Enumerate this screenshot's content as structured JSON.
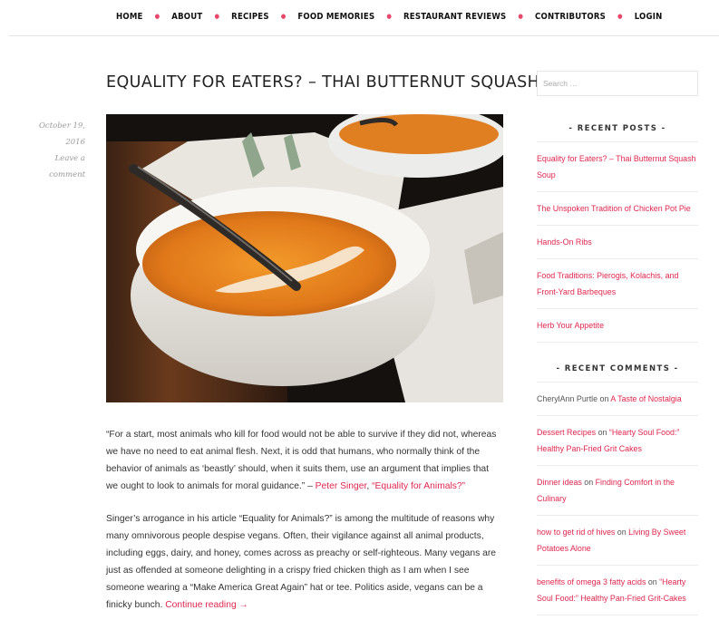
{
  "nav": {
    "items": [
      "HOME",
      "ABOUT",
      "RECIPES",
      "FOOD MEMORIES",
      "RESTAURANT REVIEWS",
      "CONTRIBUTORS",
      "LOGIN"
    ]
  },
  "post": {
    "title": "EQUALITY FOR EATERS? – THAI BUTTERNUT SQUASH SOUP",
    "date": "October 19, 2016",
    "comment_link": "Leave a comment",
    "quote_text": "“For a start, most animals who kill for food would not be able to survive if they did not, whereas we have no need to eat animal flesh. Next, it is odd that humans, who normally think of the behavior of animals as ‘beastly’ should, when it suits them, use an argument that implies that we ought to look to animals for moral guidance.” – ",
    "quote_author": "Peter Singer",
    "quote_sep": ", ",
    "quote_source": "“Equality for Animals?”",
    "body_text": "Singer’s arrogance in his article “Equality for Animals?” is among the multitude of reasons why many omnivorous people despise vegans. Often, their vigilance against all animal products, including eggs, dairy, and honey, comes across as preachy or self-righteous. Many vegans are just as offended at someone delighting in a crispy fried chicken thigh as I am when I see someone wearing a “Make America Great Again” hat or tee. Politics aside, vegans can be a finicky bunch. ",
    "continue_link": "Continue reading →"
  },
  "sidebar": {
    "search_placeholder": "Search …",
    "recent_posts_title": "- RECENT POSTS -",
    "recent_posts": [
      "Equality for Eaters? – Thai Butternut Squash Soup",
      "The Unspoken Tradition of Chicken Pot Pie",
      "Hands-On Ribs",
      "Food Traditions: Pierogis, Kolachis, and Front-Yard Barbeques",
      "Herb Your Appetite"
    ],
    "recent_comments_title": "- RECENT COMMENTS -",
    "recent_comments": [
      {
        "author": "CherylAnn Purtle",
        "on": " on ",
        "post": "A Taste of Nostalgia"
      },
      {
        "author": "Dessert Recipes",
        "on": " on ",
        "post": "“Hearty Soul Food:” Healthy Pan-Fried Grit Cakes"
      },
      {
        "author": "Dinner ideas",
        "on": " on ",
        "post": "Finding Comfort in the Culinary"
      },
      {
        "author": "how to get rid of hives",
        "on": " on ",
        "post": "Living By Sweet Potatoes Alone"
      },
      {
        "author": "benefits of omega 3 fatty acids",
        "on": " on ",
        "post": "“Hearty Soul Food:” Healthy Pan-Fried Grit-Cakes"
      }
    ]
  },
  "colors": {
    "accent": "#e0274f",
    "text": "#333333",
    "meta": "#9a9a9a"
  },
  "icons": {
    "nav_separator": "dot-separator"
  }
}
